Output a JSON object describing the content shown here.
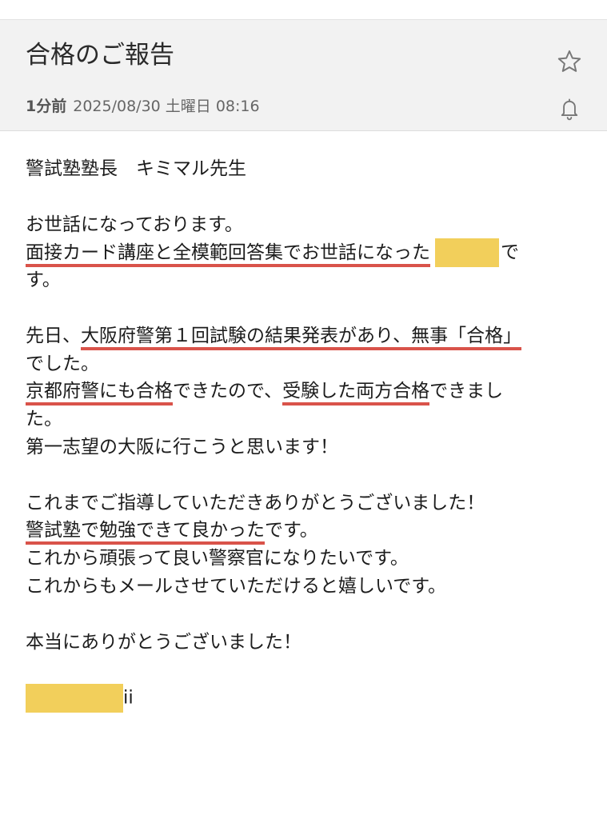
{
  "header": {
    "subject": "合格のご報告",
    "time_ago": "1分前",
    "datetime": "2025/08/30 土曜日 08:16",
    "icons": [
      "star-icon",
      "bell-icon"
    ]
  },
  "body": {
    "salutation": "警試塾塾長　キミマル先生",
    "p1_l1": "お世話になっております。",
    "p1_l2_u": "面接カード講座と全模範回答集でお世話になった",
    "p1_l2_end": "で",
    "p1_l3": "す。",
    "p2_l1_a": "先日、",
    "p2_l1_u": "大阪府警第１回試験の結果発表があり、無事「合格」",
    "p2_l2": "でした。",
    "p2_l3_u1": "京都府警にも合格",
    "p2_l3_mid": "できたので、",
    "p2_l3_u2": "受験した両方合格",
    "p2_l3_end": "できまし",
    "p2_l4": "た。",
    "p2_l5": "第一志望の大阪に行こうと思います！",
    "p3_l1": "これまでご指導していただきありがとうございました！",
    "p3_l2_u": "警試塾で勉強できて良かった",
    "p3_l2_end": "です。",
    "p3_l3": "これから頑張って良い警察官になりたいです。",
    "p3_l4": "これからもメールさせていただけると嬉しいです。",
    "closing": "本当にありがとうございました！",
    "signature_tail": "ii"
  },
  "colors": {
    "underline": "#d9534a",
    "redaction": "#f2cf5b",
    "header_bg": "#f2f2f2"
  }
}
